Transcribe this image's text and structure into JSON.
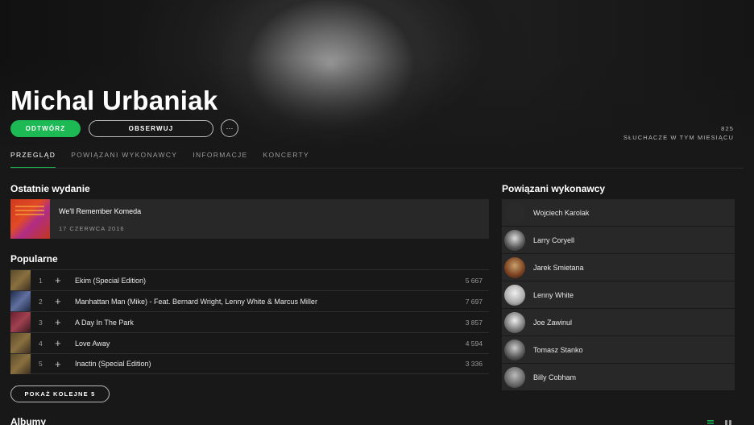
{
  "header": {
    "artist_name": "Michal Urbaniak",
    "play_label": "ODTWÓRZ",
    "follow_label": "OBSERWUJ",
    "more_label": "···",
    "listeners_count": "825",
    "listeners_label": "SŁUCHACZE W TYM MIESIĄCU"
  },
  "tabs": [
    {
      "label": "PRZEGLĄD",
      "active": true
    },
    {
      "label": "POWIĄZANI WYKONAWCY",
      "active": false
    },
    {
      "label": "INFORMACJE",
      "active": false
    },
    {
      "label": "KONCERTY",
      "active": false
    }
  ],
  "latest": {
    "heading": "Ostatnie wydanie",
    "title": "We'll Remember Komeda",
    "date": "17 CZERWCA 2016"
  },
  "popular": {
    "heading": "Popularne",
    "tracks": [
      {
        "num": "1",
        "name": "Ekim (Special Edition)",
        "plays": "5 667"
      },
      {
        "num": "2",
        "name": "Manhattan Man (Mike) - Feat. Bernard Wright, Lenny White & Marcus Miller",
        "plays": "7 697"
      },
      {
        "num": "3",
        "name": "A Day In The Park",
        "plays": "3 857"
      },
      {
        "num": "4",
        "name": "Love Away",
        "plays": "4 594"
      },
      {
        "num": "5",
        "name": "Inactin (Special Edition)",
        "plays": "3 336"
      }
    ],
    "add_icon": "+",
    "show_more_label": "POKAŻ KOLEJNE 5"
  },
  "related": {
    "heading": "Powiązani wykonawcy",
    "artists": [
      {
        "name": "Wojciech Karolak"
      },
      {
        "name": "Larry Coryell"
      },
      {
        "name": "Jarek Smietana"
      },
      {
        "name": "Lenny White"
      },
      {
        "name": "Joe Zawinul"
      },
      {
        "name": "Tomasz Stanko"
      },
      {
        "name": "Billy Cobham"
      }
    ]
  },
  "albums": {
    "heading": "Albumy"
  },
  "colors": {
    "accent": "#1db954",
    "background": "#181818",
    "card": "#282828"
  }
}
